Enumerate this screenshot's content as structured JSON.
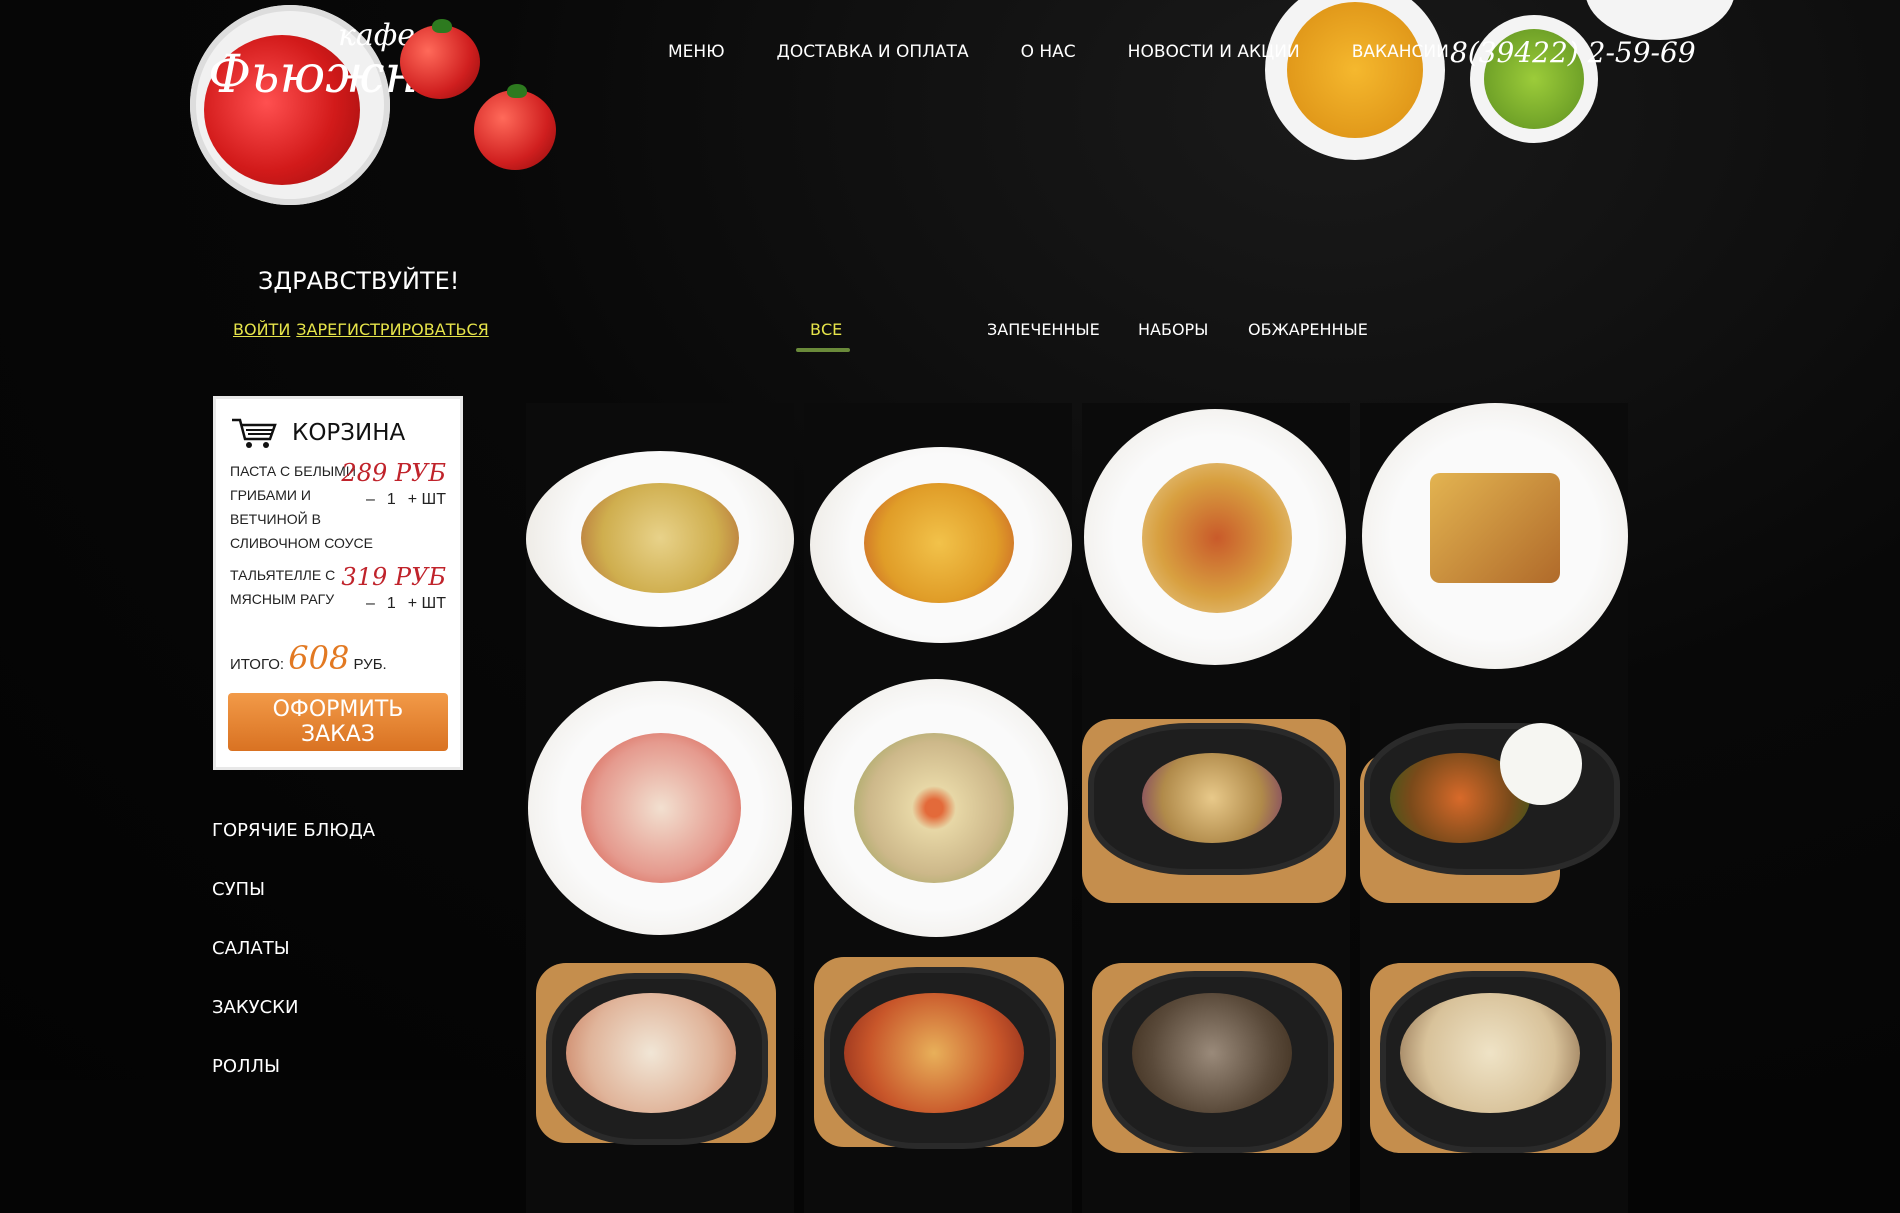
{
  "brand": {
    "name_top": "кафе",
    "name_main": "Фьюжн"
  },
  "nav": [
    {
      "label": "МЕНЮ"
    },
    {
      "label": "ДОСТАВКА И ОПЛАТА"
    },
    {
      "label": "О НАС"
    },
    {
      "label": "НОВОСТИ И АКЦИИ"
    },
    {
      "label": "ВАКАНСИИ"
    }
  ],
  "phone": "8(39422) 2-59-69",
  "greeting": "ЗДРАВСТВУЙТЕ!",
  "auth": {
    "login": "ВОЙТИ",
    "register": "ЗАРЕГИСТРИРОВАТЬСЯ"
  },
  "filters": [
    {
      "label": "ВСЕ",
      "active": true
    },
    {
      "label": "ЗАПЕЧЕННЫЕ",
      "active": false
    },
    {
      "label": "НАБОРЫ",
      "active": false
    },
    {
      "label": "ОБЖАРЕННЫЕ",
      "active": false
    }
  ],
  "cart": {
    "title": "КОРЗИНА",
    "items": [
      {
        "name": "ПАСТА С БЕЛЫМИ ГРИБАМИ И ВЕТЧИНОЙ В СЛИВОЧНОМ СОУСЕ",
        "price": "289 РУБ",
        "minus": "–",
        "qty": "1",
        "plus": "+ ШТ"
      },
      {
        "name": "ТАЛЬЯТЕЛЛЕ С МЯСНЫМ РАГУ",
        "price": "319 РУБ",
        "minus": "–",
        "qty": "1",
        "plus": "+ ШТ"
      }
    ],
    "total_label": "ИТОГО:",
    "total_value": "608",
    "total_unit": "РУБ.",
    "order_button": "ОФОРМИТЬ ЗАКАЗ"
  },
  "categories": [
    {
      "label": "ГОРЯЧИЕ БЛЮДА"
    },
    {
      "label": "СУПЫ"
    },
    {
      "label": "САЛАТЫ"
    },
    {
      "label": "ЗАКУСКИ"
    },
    {
      "label": "РОЛЛЫ"
    }
  ],
  "colors": {
    "accent_yellow": "#e6e44a",
    "price_red": "#c0232b",
    "total_orange": "#e27922",
    "button_orange": "#e5852f"
  }
}
